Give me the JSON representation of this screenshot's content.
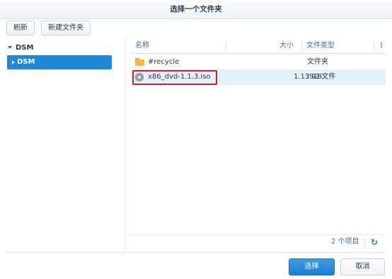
{
  "dialog": {
    "title": "选择一个文件夹"
  },
  "toolbar": {
    "refresh_label": "刷新",
    "new_folder_label": "新建文件夹"
  },
  "tree": {
    "root_label": "DSM",
    "selected_item_label": "DSM"
  },
  "table": {
    "columns": {
      "name": "名称",
      "size": "大小",
      "type": "文件类型"
    },
    "rows": [
      {
        "name": "#recycle",
        "size": "",
        "type": "文件夹",
        "icon": "folder-icon"
      },
      {
        "name": "x86_dvd-1.1.3.iso",
        "size": "1.13 GB",
        "type": "ISO 文件",
        "icon": "disc-image-icon",
        "highlighted": true
      }
    ]
  },
  "footer": {
    "item_count": "2 个项目"
  },
  "actions": {
    "select_label": "选择",
    "cancel_label": "取消"
  },
  "colors": {
    "accent": "#1c88d8",
    "highlight_border": "#e11b1b",
    "selected_row": "#e4f2fb"
  }
}
